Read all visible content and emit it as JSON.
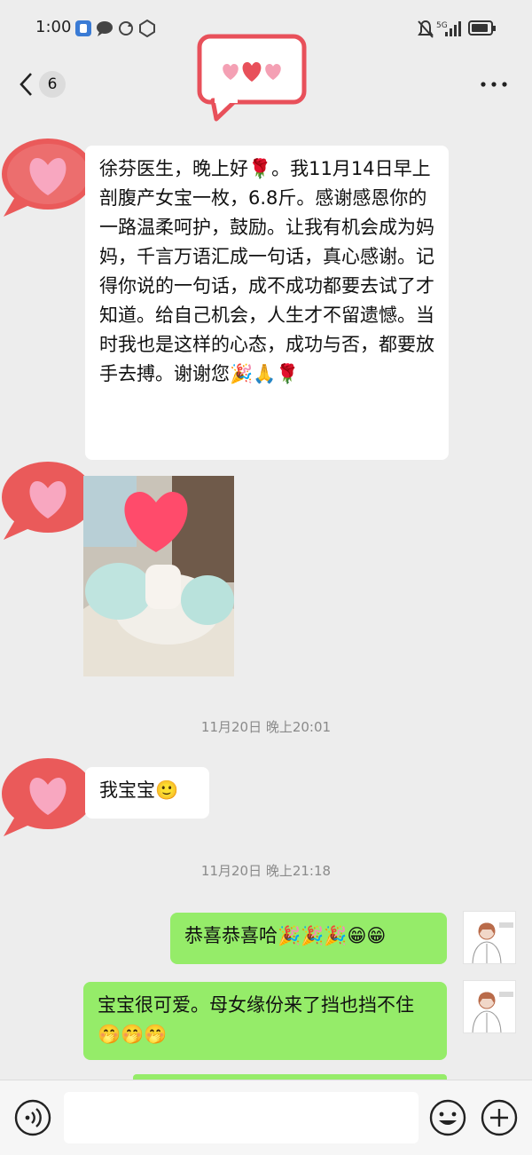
{
  "status_bar": {
    "time": "1:00",
    "network": "5G"
  },
  "nav": {
    "unread_count": "6"
  },
  "messages": [
    {
      "side": "left",
      "type": "text",
      "text": "徐芬医生，晚上好🌹。我11月14日早上剖腹产女宝一枚，6.8斤。感谢感恩你的一路温柔呵护，鼓励。让我有机会成为妈妈，千言万语汇成一句话，真心感谢。记得你说的一句话，成不成功都要去试了才知道。给自己机会，人生才不留遗憾。当时我也是这样的心态，成功与否，都要放手去搏。谢谢您🎉🙏🌹"
    },
    {
      "side": "left",
      "type": "image",
      "alt": "baby-photo"
    },
    {
      "type": "timestamp",
      "text": "11月20日 晚上20:01"
    },
    {
      "side": "left",
      "type": "text",
      "text": "我宝宝🙂"
    },
    {
      "type": "timestamp",
      "text": "11月20日 晚上21:18"
    },
    {
      "side": "right",
      "type": "text",
      "text": "恭喜恭喜哈🎉🎉🎉😁😁"
    },
    {
      "side": "right",
      "type": "text",
      "text": "宝宝很可爱。母女缘份来了挡也挡不住🤭🤭🤭"
    }
  ],
  "icons": {
    "back": "chevron-left-icon",
    "more": "more-dots-icon",
    "voice": "voice-icon",
    "emoji": "emoji-icon",
    "add": "plus-icon"
  },
  "colors": {
    "background": "#ededed",
    "bubble_left": "#ffffff",
    "bubble_right": "#95ec69",
    "heart": "#ea5a5a"
  }
}
